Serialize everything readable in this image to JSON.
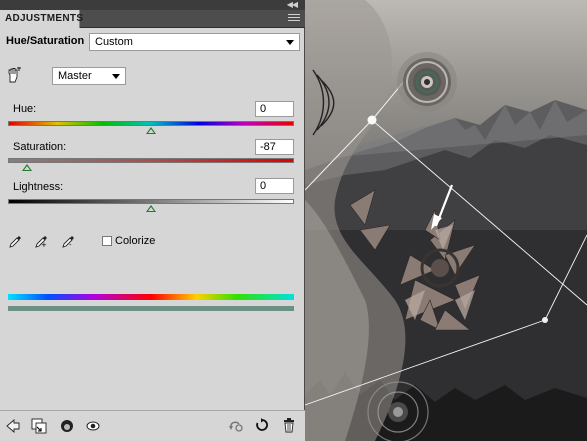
{
  "panel": {
    "tab_title": "ADJUSTMENTS",
    "collapse_glyph": "◀◀",
    "menu_icon": "panel-menu-icon",
    "adjustment_name": "Hue/Saturation",
    "preset": "Custom",
    "channel": "Master",
    "hue": {
      "label": "Hue:",
      "value": "0",
      "level": 0.5
    },
    "saturation": {
      "label": "Saturation:",
      "value": "-87",
      "level": 0.065
    },
    "lightness": {
      "label": "Lightness:",
      "value": "0",
      "level": 0.5
    },
    "colorize_label": "Colorize",
    "colorize_checked": false
  },
  "colors": {
    "panel_bg": "#d6d6d6",
    "thumb": "#1f7a2a",
    "bottom_bar_bottom": "#6c8f86"
  },
  "footer_icons": [
    "back-arrow-icon",
    "clip-to-layer-icon",
    "visibility-mask-icon",
    "eye-icon",
    "previous-state-icon",
    "reset-icon",
    "trash-icon"
  ]
}
